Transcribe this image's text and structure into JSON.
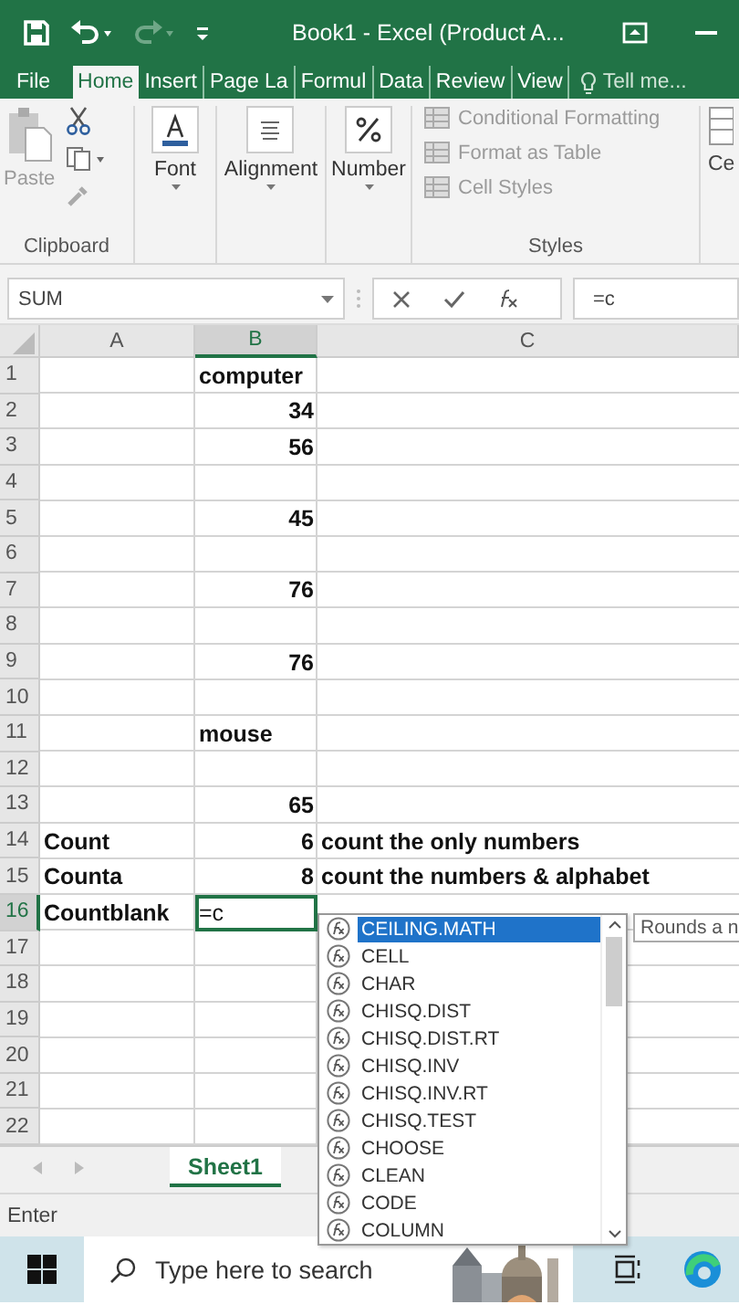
{
  "window": {
    "title": "Book1 - Excel (Product A..."
  },
  "quick_access": [
    {
      "kind": "save",
      "disabled": false
    },
    {
      "kind": "undo",
      "disabled": false
    },
    {
      "kind": "redo",
      "disabled": true
    },
    {
      "kind": "customize",
      "disabled": false
    }
  ],
  "tabs": [
    {
      "label": "File",
      "selected": false
    },
    {
      "label": "Home",
      "selected": true
    },
    {
      "label": "Insert",
      "selected": false
    },
    {
      "label": "Page La",
      "selected": false
    },
    {
      "label": "Formul",
      "selected": false
    },
    {
      "label": "Data",
      "selected": false
    },
    {
      "label": "Review",
      "selected": false
    },
    {
      "label": "View",
      "selected": false
    }
  ],
  "tell_me": "Tell me...",
  "ribbon": {
    "clipboard": {
      "paste": "Paste",
      "paste_disabled": true,
      "label": "Clipboard"
    },
    "buttons": [
      {
        "label": "Font",
        "kind": "font"
      },
      {
        "label": "Alignment",
        "kind": "align"
      },
      {
        "label": "Number",
        "kind": "number"
      }
    ],
    "styles": [
      {
        "label": "Conditional Formatting",
        "disabled": true
      },
      {
        "label": "Format as Table",
        "disabled": true
      },
      {
        "label": "Cell Styles",
        "disabled": true
      }
    ],
    "styles_label": "Styles",
    "cells_label": "Ce"
  },
  "formula_bar": {
    "name_box": "SUM",
    "value": "=c"
  },
  "columns": [
    {
      "label": "A",
      "selected": false
    },
    {
      "label": "B",
      "selected": true
    },
    {
      "label": "C",
      "selected": false
    }
  ],
  "rows": [
    {
      "number": "1",
      "selected": false,
      "b": {
        "text": "computer",
        "kind": "text",
        "selected": false
      }
    },
    {
      "number": "2",
      "selected": false,
      "b": {
        "text": "34",
        "kind": "number",
        "selected": false
      }
    },
    {
      "number": "3",
      "selected": false,
      "b": {
        "text": "56",
        "kind": "number",
        "selected": false
      }
    },
    {
      "number": "4",
      "selected": false
    },
    {
      "number": "5",
      "selected": false,
      "b": {
        "text": "45",
        "kind": "number",
        "selected": false
      }
    },
    {
      "number": "6",
      "selected": false
    },
    {
      "number": "7",
      "selected": false,
      "b": {
        "text": "76",
        "kind": "number",
        "selected": false
      }
    },
    {
      "number": "8",
      "selected": false
    },
    {
      "number": "9",
      "selected": false,
      "b": {
        "text": "76",
        "kind": "number",
        "selected": false
      }
    },
    {
      "number": "10",
      "selected": false
    },
    {
      "number": "11",
      "selected": false,
      "b": {
        "text": "mouse",
        "kind": "text",
        "selected": false
      }
    },
    {
      "number": "12",
      "selected": false
    },
    {
      "number": "13",
      "selected": false,
      "b": {
        "text": "65",
        "kind": "number",
        "selected": false
      }
    },
    {
      "number": "14",
      "selected": false,
      "a": "Count",
      "b": {
        "text": "6",
        "kind": "number",
        "selected": false
      },
      "c": "count the only numbers"
    },
    {
      "number": "15",
      "selected": false,
      "a": "Counta",
      "b": {
        "text": "8",
        "kind": "number",
        "selected": false
      },
      "c": "count the numbers & alphabet"
    },
    {
      "number": "16",
      "selected": true,
      "a": "Countblank",
      "b": {
        "text": "=c",
        "kind": "text",
        "selected": true
      }
    },
    {
      "number": "17",
      "selected": false
    },
    {
      "number": "18",
      "selected": false
    },
    {
      "number": "19",
      "selected": false
    },
    {
      "number": "20",
      "selected": false
    },
    {
      "number": "21",
      "selected": false
    },
    {
      "number": "22",
      "selected": false
    }
  ],
  "autocomplete": {
    "items": [
      {
        "label": "CEILING.MATH",
        "selected": true
      },
      {
        "label": "CELL",
        "selected": false
      },
      {
        "label": "CHAR",
        "selected": false
      },
      {
        "label": "CHISQ.DIST",
        "selected": false
      },
      {
        "label": "CHISQ.DIST.RT",
        "selected": false
      },
      {
        "label": "CHISQ.INV",
        "selected": false
      },
      {
        "label": "CHISQ.INV.RT",
        "selected": false
      },
      {
        "label": "CHISQ.TEST",
        "selected": false
      },
      {
        "label": "CHOOSE",
        "selected": false
      },
      {
        "label": "CLEAN",
        "selected": false
      },
      {
        "label": "CODE",
        "selected": false
      },
      {
        "label": "COLUMN",
        "selected": false
      }
    ],
    "tooltip": "Rounds a n"
  },
  "sheet_tabs": [
    {
      "label": "Sheet1",
      "selected": true
    }
  ],
  "status_bar": {
    "mode": "Enter"
  },
  "taskbar": {
    "search_placeholder": "Type here to search"
  }
}
